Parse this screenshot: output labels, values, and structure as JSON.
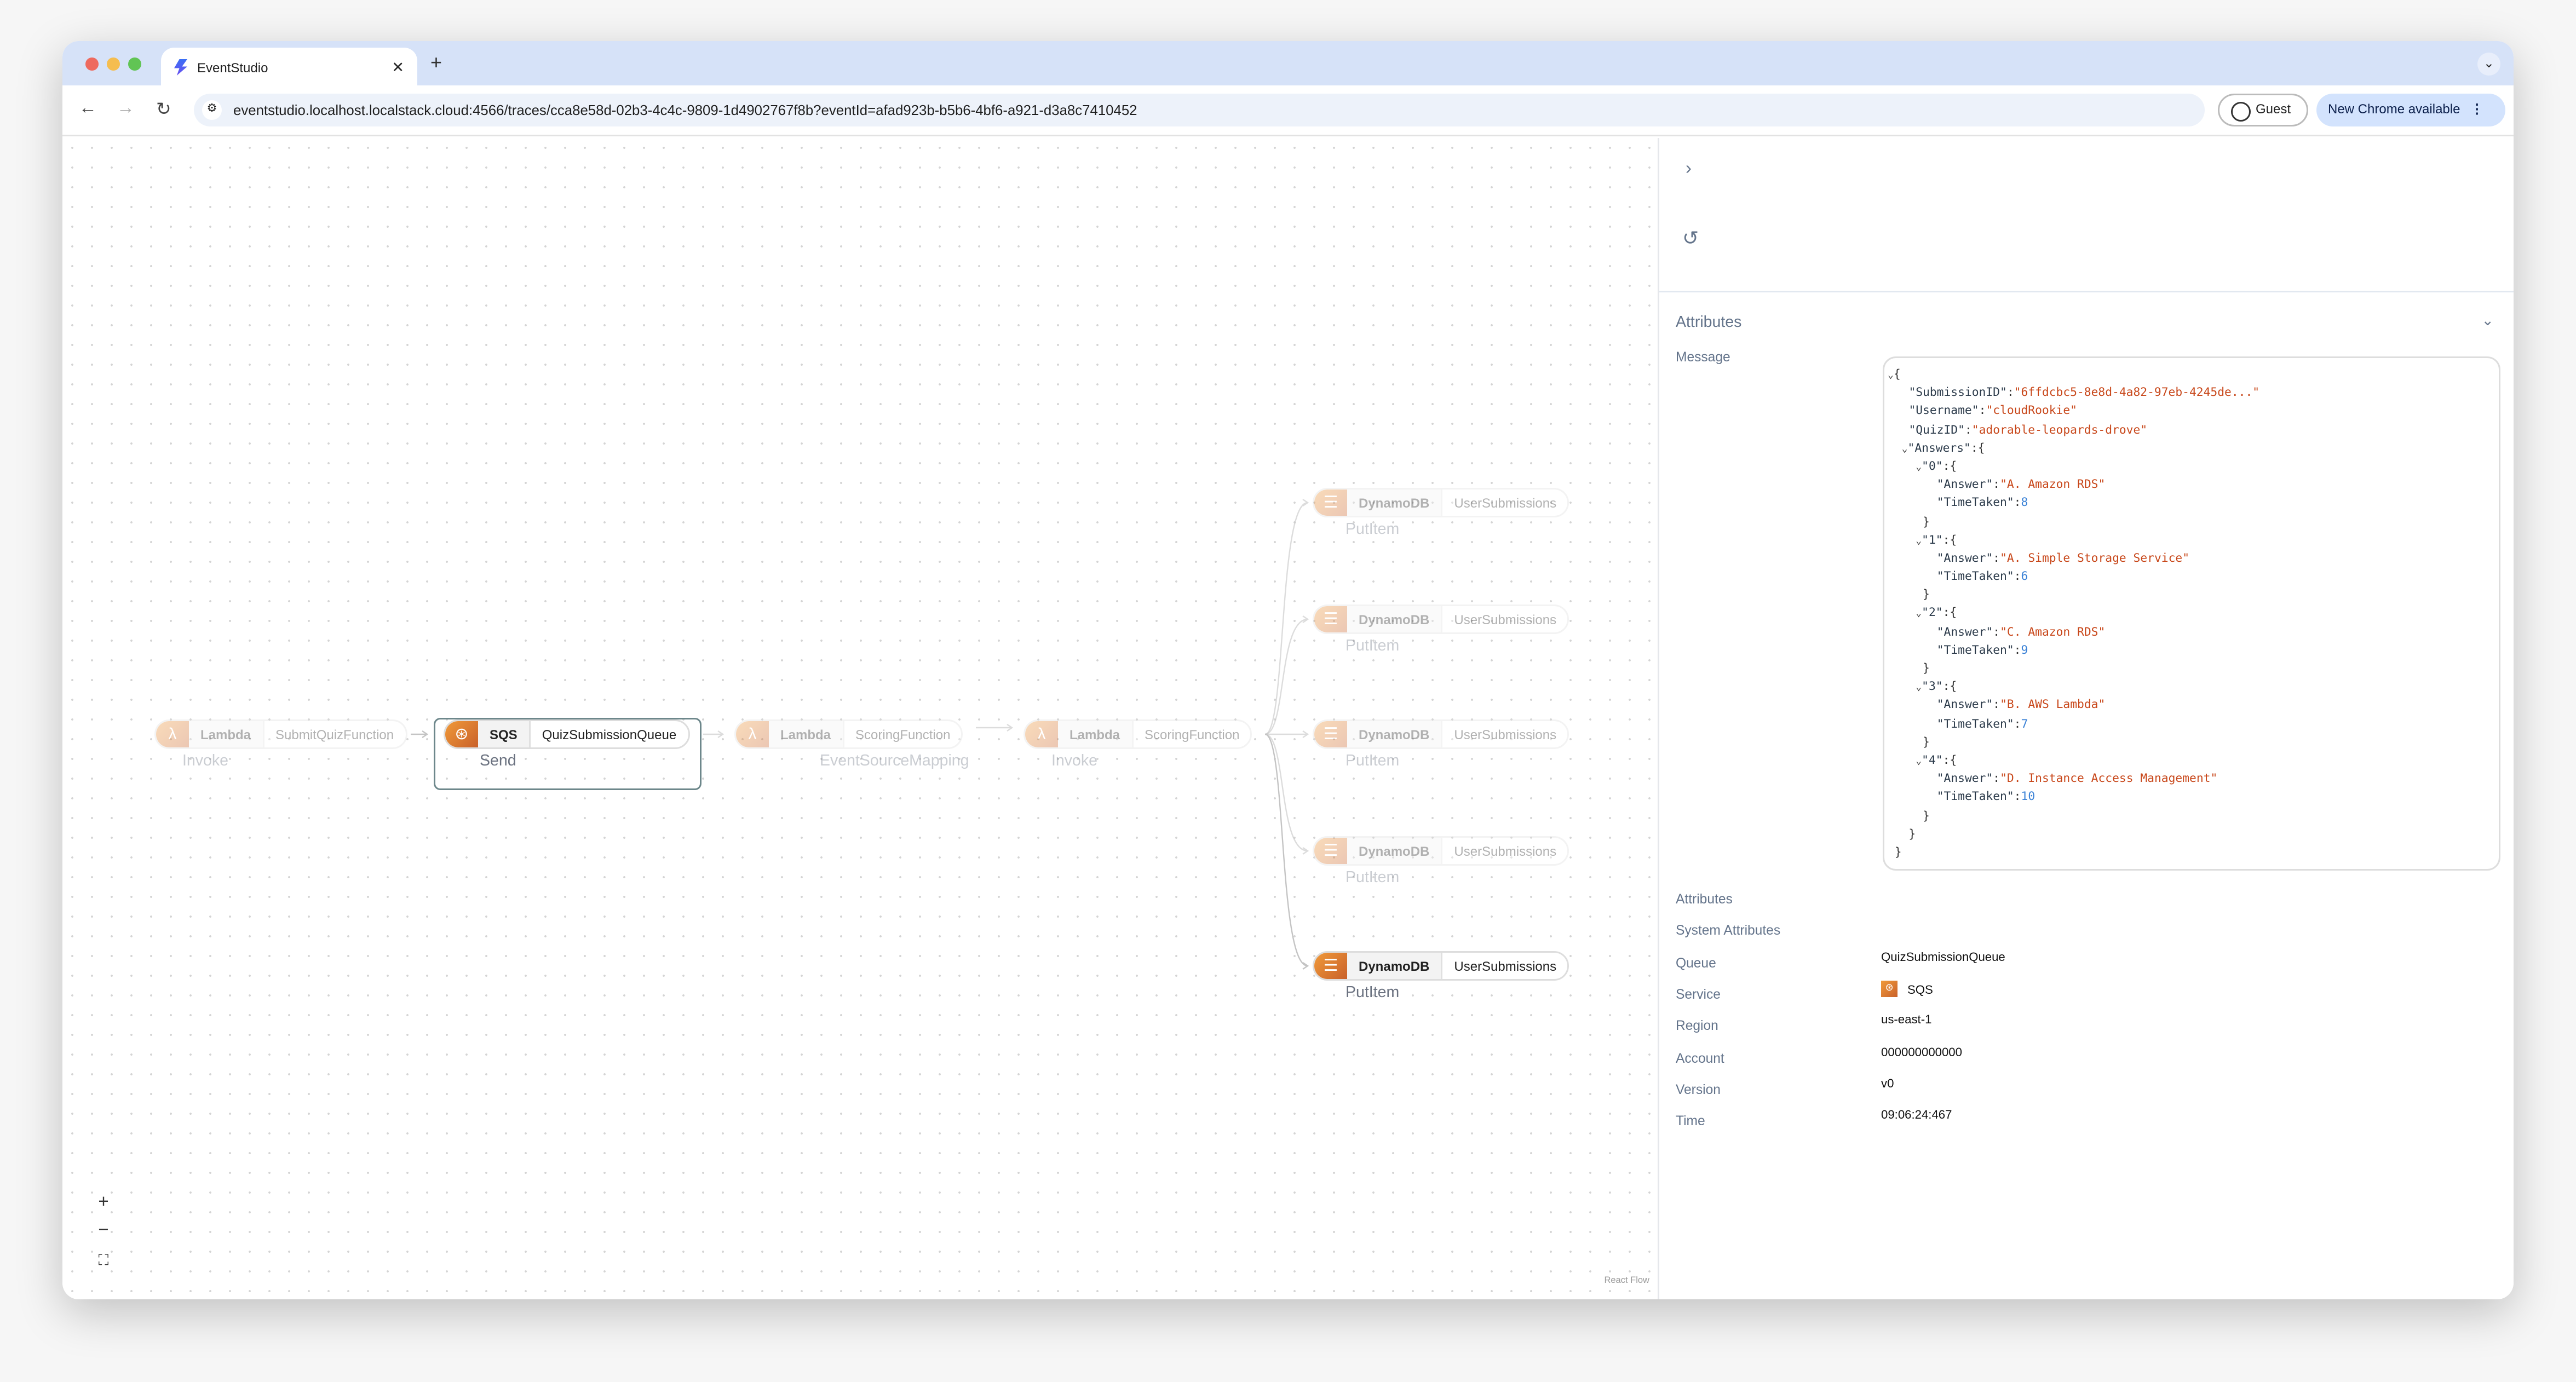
{
  "browser": {
    "tab_title": "EventStudio",
    "url": "eventstudio.localhost.localstack.cloud:4566/traces/cca8e58d-02b3-4c4c-9809-1d4902767f8b?eventId=afad923b-b5b6-4bf6-a921-d3a8c7410452",
    "guest_label": "Guest",
    "update_label": "New Chrome available"
  },
  "flow": {
    "nodes": [
      {
        "service": "Lambda",
        "resource": "SubmitQuizFunction",
        "operation": "Invoke",
        "state": "faded"
      },
      {
        "service": "SQS",
        "resource": "QuizSubmissionQueue",
        "operation": "Send",
        "state": "selected"
      },
      {
        "service": "Lambda",
        "resource": "ScoringFunction",
        "operation": "EventSourceMapping",
        "state": "faded"
      },
      {
        "service": "Lambda",
        "resource": "ScoringFunction",
        "operation": "Invoke",
        "state": "faded"
      },
      {
        "service": "DynamoDB",
        "resource": "UserSubmissions",
        "operation": "PutItem",
        "state": "faded"
      },
      {
        "service": "DynamoDB",
        "resource": "UserSubmissions",
        "operation": "PutItem",
        "state": "faded"
      },
      {
        "service": "DynamoDB",
        "resource": "UserSubmissions",
        "operation": "PutItem",
        "state": "faded"
      },
      {
        "service": "DynamoDB",
        "resource": "UserSubmissions",
        "operation": "PutItem",
        "state": "faded"
      },
      {
        "service": "DynamoDB",
        "resource": "UserSubmissions",
        "operation": "PutItem",
        "state": "active"
      }
    ],
    "controls": {
      "zoom_in": "+",
      "zoom_out": "−",
      "fit": "⛶"
    },
    "attribution": "React Flow"
  },
  "panel": {
    "section_title": "Attributes",
    "message_label": "Message",
    "message": {
      "SubmissionID": "6ffdcbc5-8e8d-4a82-97eb-4245de...",
      "Username": "cloudRookie",
      "QuizID": "adorable-leopards-drove",
      "Answers": {
        "0": {
          "Answer": "A. Amazon RDS",
          "TimeTaken": 8
        },
        "1": {
          "Answer": "A. Simple Storage Service",
          "TimeTaken": 6
        },
        "2": {
          "Answer": "C. Amazon RDS",
          "TimeTaken": 9
        },
        "3": {
          "Answer": "B. AWS Lambda",
          "TimeTaken": 7
        },
        "4": {
          "Answer": "D. Instance Access Management",
          "TimeTaken": 10
        }
      }
    },
    "rows": [
      {
        "label": "Attributes",
        "value": ""
      },
      {
        "label": "System Attributes",
        "value": ""
      },
      {
        "label": "Queue",
        "value": "QuizSubmissionQueue"
      },
      {
        "label": "Service",
        "value": "SQS"
      },
      {
        "label": "Region",
        "value": "us-east-1"
      },
      {
        "label": "Account",
        "value": "000000000000"
      },
      {
        "label": "Version",
        "value": "v0"
      },
      {
        "label": "Time",
        "value": "09:06:24:467"
      }
    ]
  },
  "colors": {
    "aws_orange": "#e0782f",
    "selected_border": "#6d878b",
    "json_string": "#c8471a",
    "json_number": "#3b82d6"
  }
}
